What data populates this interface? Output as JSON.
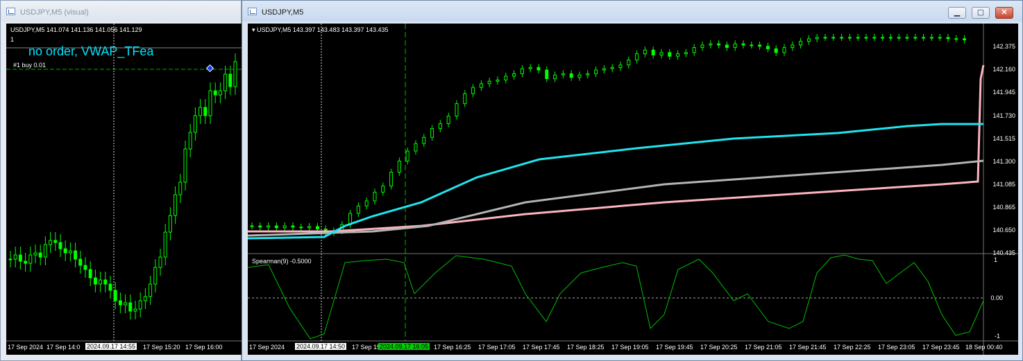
{
  "left_window": {
    "title": "USDJPY,M5 (visual)",
    "ohlc_line": "USDJPY,M5  141.074 141.136 141.056 141.129",
    "sub_line": "1",
    "overlay_text": "no order, VWAP_TFea",
    "order_label": "#1 buy 0.01",
    "time_labels": [
      "17 Sep 2024",
      "17 Sep 14:0",
      "2024.09.17 14:55",
      "17 Sep 15:20",
      "17 Sep 16:00"
    ]
  },
  "right_window": {
    "title": "USDJPY,M5",
    "buttons": {
      "minimize": "▁",
      "maximize": "▢",
      "close": "✕"
    },
    "ohlc_line": "USDJPY,M5  143.397 143.483 143.397 143.435",
    "price_labels": [
      "142.375",
      "142.160",
      "141.945",
      "141.730",
      "141.515",
      "141.300",
      "141.085",
      "140.865",
      "140.650",
      "140.435"
    ],
    "indicator_label": "Spearman(9) -0.5000",
    "indicator_scale": [
      "1",
      "0.00",
      "-1"
    ],
    "time_labels": [
      "17 Sep 2024",
      "2024.09.17 14:50",
      "17 Sep 15:05",
      "2024.09.17 16:05",
      "17 Sep 16:25",
      "17 Sep 17:05",
      "17 Sep 17:45",
      "17 Sep 18:25",
      "17 Sep 19:05",
      "17 Sep 19:45",
      "17 Sep 20:25",
      "17 Sep 21:05",
      "17 Sep 21:45",
      "17 Sep 22:25",
      "17 Sep 23:05",
      "17 Sep 23:45",
      "18 Sep 00:40"
    ]
  },
  "colors": {
    "bg": "#000000",
    "candle": "#00ff00",
    "vwap_cyan": "#1ee6f0",
    "vwap_gray": "#b4b4b4",
    "vwap_pink": "#ffb4c0",
    "overlay_text": "#00e5ff"
  }
}
